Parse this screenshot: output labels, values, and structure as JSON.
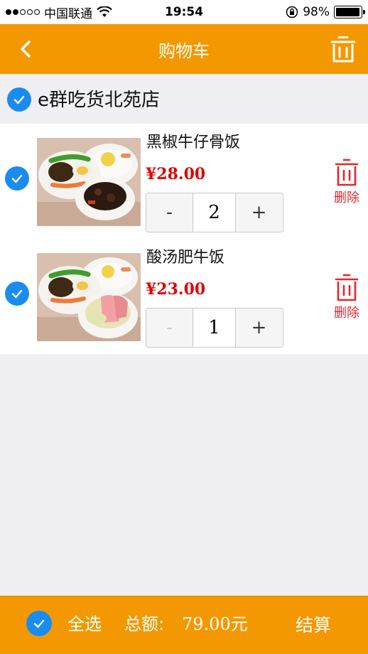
{
  "status_bar": {
    "carrier": "中国联通",
    "time": "19:54",
    "battery": "98%",
    "battery_level": 0.98,
    "signal_bars_filled": 2,
    "signal_bars_total": 5
  },
  "nav": {
    "title": "购物车",
    "back_icon": "chevron-left-icon",
    "trash_icon": "trash-icon"
  },
  "store": {
    "name": "e群吃货北苑店",
    "checked": true
  },
  "items": [
    {
      "name": "黑椒牛仔骨饭",
      "price": "¥28.00",
      "quantity": "2",
      "minus": "-",
      "plus": "+",
      "delete_label": "删除",
      "checked": true,
      "minus_disabled": false
    },
    {
      "name": "酸汤肥牛饭",
      "price": "¥23.00",
      "quantity": "1",
      "minus": "-",
      "plus": "+",
      "delete_label": "删除",
      "checked": true,
      "minus_disabled": true
    }
  ],
  "footer": {
    "select_all_label": "全选",
    "total_label": "总额:",
    "total_amount": "79.00元",
    "checkout_label": "结算",
    "select_all_checked": true
  },
  "colors": {
    "accent": "#f39800",
    "check": "#1a8cf0",
    "price": "#e00000",
    "delete": "#e5262b",
    "background": "#efeff4"
  }
}
